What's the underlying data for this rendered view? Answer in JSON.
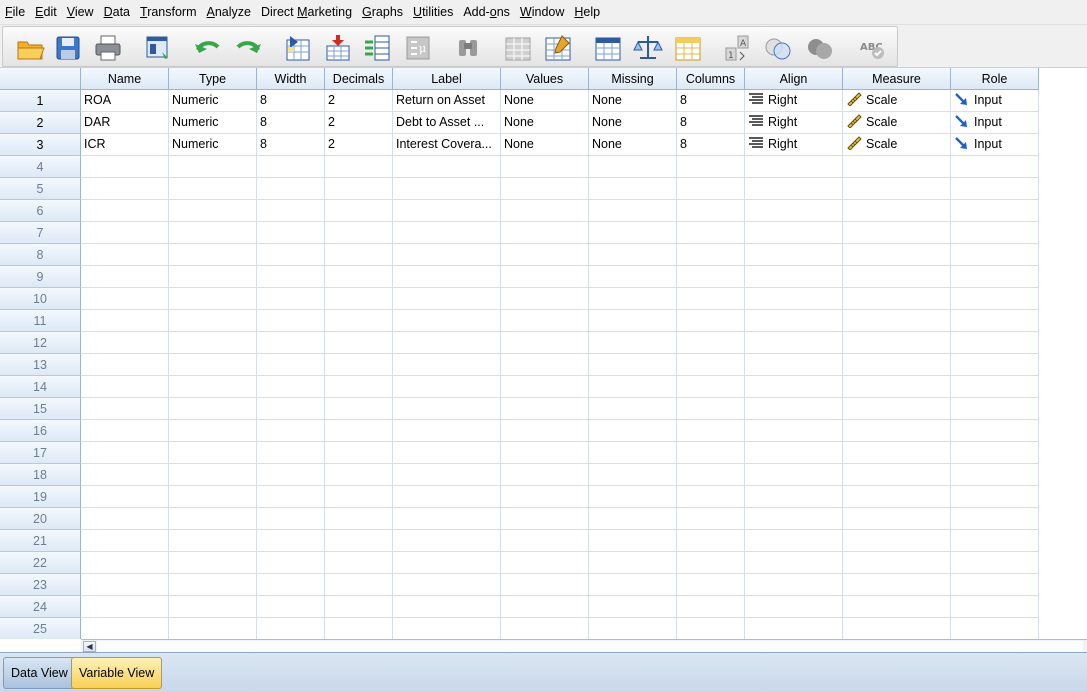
{
  "menu": [
    "File",
    "Edit",
    "View",
    "Data",
    "Transform",
    "Analyze",
    "Direct Marketing",
    "Graphs",
    "Utilities",
    "Add-ons",
    "Window",
    "Help"
  ],
  "menu_mnemonics": [
    "F",
    "E",
    "V",
    "D",
    "T",
    "A",
    "M",
    "G",
    "U",
    "o",
    "W",
    "H"
  ],
  "toolbar": {
    "buttons": [
      {
        "name": "open-data-document-icon"
      },
      {
        "name": "save-icon"
      },
      {
        "name": "print-icon"
      },
      {
        "name": "recall-dialog-icon"
      },
      {
        "name": "undo-icon"
      },
      {
        "name": "redo-icon"
      },
      {
        "name": "go-to-case-icon"
      },
      {
        "name": "go-to-variable-icon"
      },
      {
        "name": "variables-icon"
      },
      {
        "name": "run-descriptive-statistics-icon"
      },
      {
        "name": "find-icon"
      },
      {
        "name": "insert-cases-icon"
      },
      {
        "name": "insert-variable-icon"
      },
      {
        "name": "split-file-icon"
      },
      {
        "name": "weight-cases-icon"
      },
      {
        "name": "select-cases-icon"
      },
      {
        "name": "value-labels-icon"
      },
      {
        "name": "use-variable-sets-icon"
      },
      {
        "name": "show-all-variables-icon"
      },
      {
        "name": "spell-check-icon"
      }
    ]
  },
  "grid": {
    "columns": [
      "Name",
      "Type",
      "Width",
      "Decimals",
      "Label",
      "Values",
      "Missing",
      "Columns",
      "Align",
      "Measure",
      "Role"
    ],
    "rows": [
      {
        "num": "1",
        "cells": [
          "ROA",
          "Numeric",
          "8",
          "2",
          "Return on Asset",
          "None",
          "None",
          "8",
          "Right",
          "Scale",
          "Input"
        ]
      },
      {
        "num": "2",
        "cells": [
          "DAR",
          "Numeric",
          "8",
          "2",
          "Debt to Asset ...",
          "None",
          "None",
          "8",
          "Right",
          "Scale",
          "Input"
        ]
      },
      {
        "num": "3",
        "cells": [
          "ICR",
          "Numeric",
          "8",
          "2",
          "Interest Covera...",
          "None",
          "None",
          "8",
          "Right",
          "Scale",
          "Input"
        ]
      }
    ],
    "empty_row_numbers": [
      "4",
      "5",
      "6",
      "7",
      "8",
      "9",
      "10",
      "11",
      "12",
      "13",
      "14",
      "15",
      "16",
      "17",
      "18",
      "19",
      "20",
      "21",
      "22",
      "23",
      "24",
      "25"
    ]
  },
  "tabs": {
    "data_view": "Data View",
    "variable_view": "Variable View",
    "active": "Variable View"
  },
  "colors": {
    "header_blue": "#dde9f6",
    "active_tab_yellow": "#f7cf55",
    "grid_line": "#d4dfeb"
  }
}
